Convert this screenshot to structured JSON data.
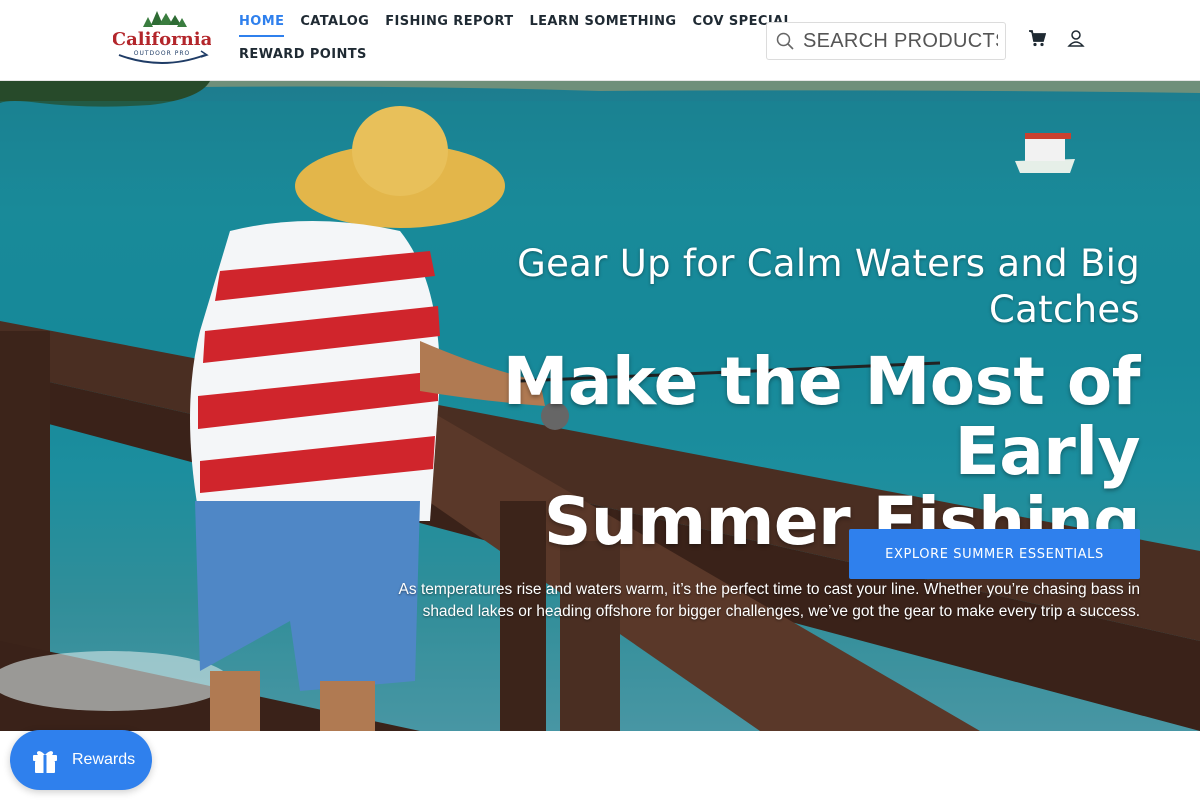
{
  "brand": {
    "logo_alt": "California Outdoor Pro",
    "logo_text": "California",
    "logo_subtext": "OUTDOOR PRO"
  },
  "nav": {
    "items": [
      {
        "label": "HOME",
        "active": true
      },
      {
        "label": "CATALOG",
        "active": false
      },
      {
        "label": "FISHING REPORT",
        "active": false
      },
      {
        "label": "LEARN SOMETHING",
        "active": false
      },
      {
        "label": "COV SPECIAL",
        "active": false
      },
      {
        "label": "REWARD POINTS",
        "active": false
      }
    ]
  },
  "search": {
    "placeholder": "SEARCH PRODUCTS...",
    "icon": "search-icon"
  },
  "header_icons": {
    "cart": "cart-icon",
    "account": "user-icon"
  },
  "hero": {
    "subtitle": "Gear Up for Calm Waters and Big Catches",
    "title_line1": "Make the Most of Early",
    "title_line2": "Summer Fishing",
    "body": "As temperatures rise and waters warm, it’s the perfect time to cast your line. Whether you’re chasing bass in shaded lakes or heading offshore for bigger challenges, we’ve got the gear to make every trip a success.",
    "cta_label": "EXPLORE SUMMER ESSENTIALS"
  },
  "rewards": {
    "label": "Rewards",
    "icon": "gift-icon"
  },
  "colors": {
    "accent": "#2f80ed",
    "nav_text": "#1f2a33",
    "hero_text": "#ffffff"
  }
}
